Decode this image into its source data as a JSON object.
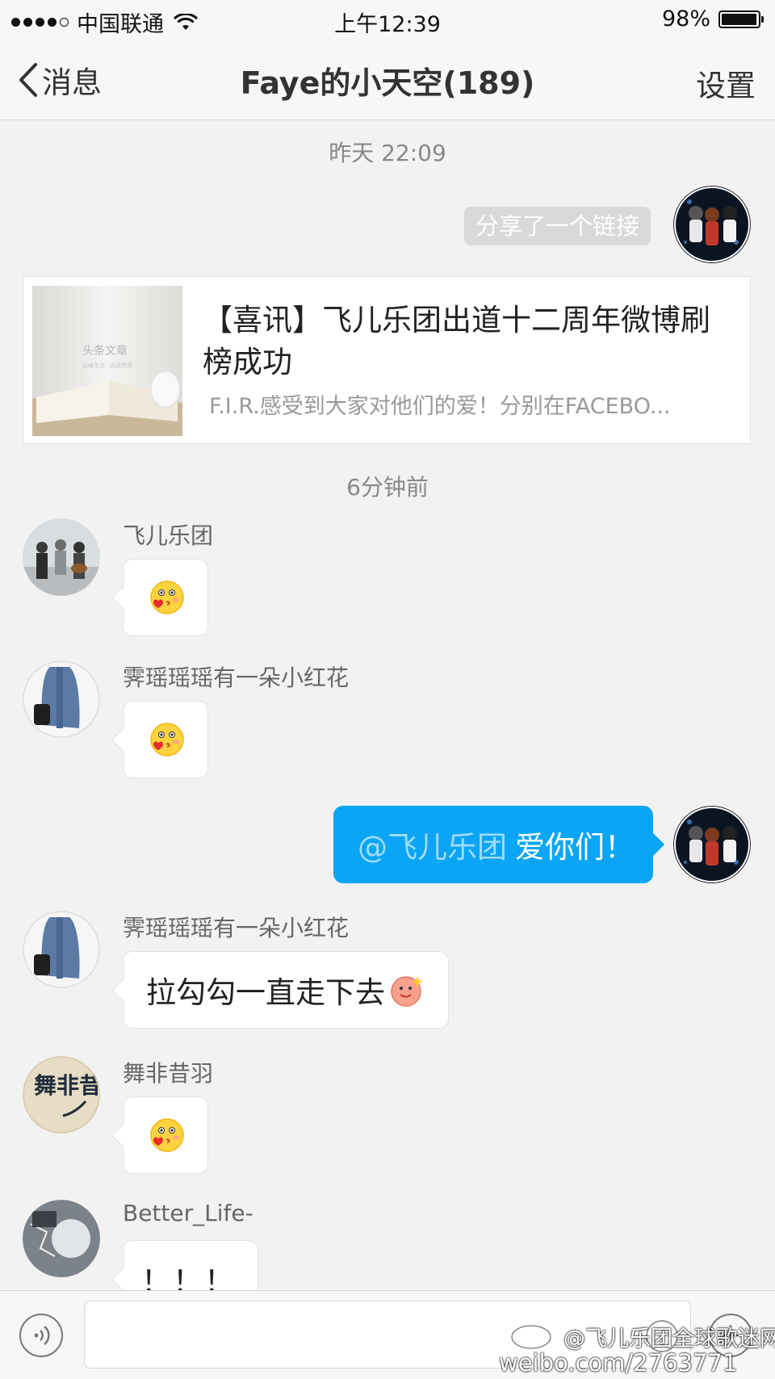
{
  "status_bar": {
    "carrier": "中国联通",
    "time": "上午12:39",
    "battery_percent": "98%",
    "battery_level": 0.98,
    "signal_bars": 4
  },
  "nav": {
    "back_label": "消息",
    "title": "Faye的小天空(189)",
    "settings_label": "设置"
  },
  "chat": {
    "timestamp_1": "昨天 22:09",
    "share_tag": "分享了一个链接",
    "link_card": {
      "title": "【喜讯】飞儿乐团出道十二周年微博刷榜成功",
      "description": "F.I.R.感受到大家对他们的爱！分别在FACEBO...",
      "thumb_caption": "头条文章",
      "thumb_subcaption": "品味生活 · 阅读世界"
    },
    "timestamp_2": "6分钟前",
    "messages": [
      {
        "sender": "飞儿乐团",
        "emoji": "blush-kiss-emoji"
      },
      {
        "sender": "霁瑶瑶瑶有一朵小红花",
        "emoji": "blush-kiss-emoji"
      },
      {
        "mention": "@飞儿乐团",
        "text": "爱你们！"
      },
      {
        "sender": "霁瑶瑶瑶有一朵小红花",
        "text": "拉勾勾一直走下去"
      },
      {
        "sender": "舞非昔羽",
        "emoji": "blush-kiss-emoji"
      },
      {
        "sender": "Better_Life-",
        "text": "！！！"
      }
    ],
    "avatar_text_wufeixiyu": "舞非昔羽"
  },
  "watermark": {
    "line1": "@飞儿乐团全球歌迷网",
    "line2": "weibo.com/2763771"
  },
  "colors": {
    "my_bubble": "#0ba5f5",
    "background": "#f2f2f2"
  }
}
